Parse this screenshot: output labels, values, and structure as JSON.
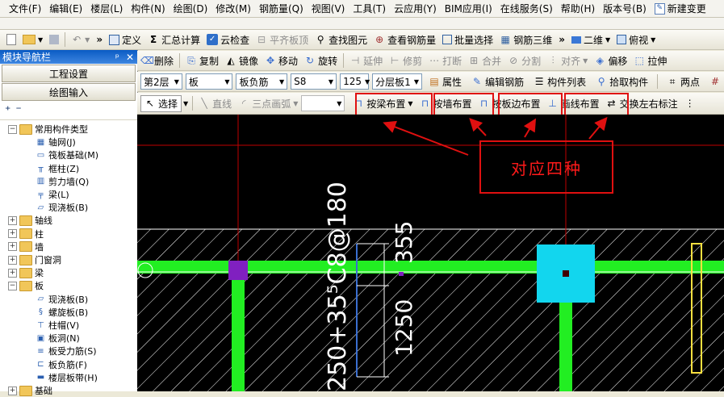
{
  "menubar": [
    "文件(F)",
    "编辑(E)",
    "楼层(L)",
    "构件(N)",
    "绘图(D)",
    "修改(M)",
    "钢筋量(Q)",
    "视图(V)",
    "工具(T)",
    "云应用(Y)",
    "BIM应用(I)",
    "在线服务(S)",
    "帮助(H)",
    "版本号(B)",
    "新建变更"
  ],
  "toolbar1": {
    "define": "定义",
    "sum": "汇总计算",
    "cloud_check": "云检查",
    "flush_slab": "平齐板顶",
    "find": "查找图元",
    "view_rebar": "查看钢筋量",
    "batch_select": "批量选择",
    "rebar_3d": "钢筋三维",
    "view_mode": "二维",
    "view_dir": "俯视"
  },
  "nav": {
    "title": "模块导航栏",
    "pin": "ᵖ",
    "close": "✕",
    "btn_project": "工程设置",
    "btn_draw": "绘图输入",
    "tree": [
      {
        "label": "常用构件类型",
        "level": 0,
        "type": "folder",
        "exp": "−"
      },
      {
        "label": "轴网(J)",
        "level": 1,
        "type": "leaf",
        "icon": "grid"
      },
      {
        "label": "筏板基础(M)",
        "level": 1,
        "type": "leaf",
        "icon": "raft"
      },
      {
        "label": "框柱(Z)",
        "level": 1,
        "type": "leaf",
        "icon": "column"
      },
      {
        "label": "剪力墙(Q)",
        "level": 1,
        "type": "leaf",
        "icon": "wall"
      },
      {
        "label": "梁(L)",
        "level": 1,
        "type": "leaf",
        "icon": "beam"
      },
      {
        "label": "现浇板(B)",
        "level": 1,
        "type": "leaf",
        "icon": "slab"
      },
      {
        "label": "轴线",
        "level": 0,
        "type": "folder",
        "exp": "+"
      },
      {
        "label": "柱",
        "level": 0,
        "type": "folder",
        "exp": "+"
      },
      {
        "label": "墙",
        "level": 0,
        "type": "folder",
        "exp": "+"
      },
      {
        "label": "门窗洞",
        "level": 0,
        "type": "folder",
        "exp": "+"
      },
      {
        "label": "梁",
        "level": 0,
        "type": "folder",
        "exp": "+"
      },
      {
        "label": "板",
        "level": 0,
        "type": "folder",
        "exp": "−"
      },
      {
        "label": "现浇板(B)",
        "level": 1,
        "type": "leaf",
        "icon": "slab"
      },
      {
        "label": "螺旋板(B)",
        "level": 1,
        "type": "leaf",
        "icon": "spiral"
      },
      {
        "label": "柱帽(V)",
        "level": 1,
        "type": "leaf",
        "icon": "cap"
      },
      {
        "label": "板洞(N)",
        "level": 1,
        "type": "leaf",
        "icon": "hole"
      },
      {
        "label": "板受力筋(S)",
        "level": 1,
        "type": "leaf",
        "icon": "rebar"
      },
      {
        "label": "板负筋(F)",
        "level": 1,
        "type": "leaf",
        "icon": "negrebar"
      },
      {
        "label": "楼层板带(H)",
        "level": 1,
        "type": "leaf",
        "icon": "band"
      },
      {
        "label": "基础",
        "level": 0,
        "type": "folder",
        "exp": "+"
      }
    ]
  },
  "toolbar2": {
    "delete": "删除",
    "copy": "复制",
    "mirror": "镜像",
    "move": "移动",
    "rotate": "旋转",
    "extend": "延伸",
    "trim": "修剪",
    "break": "打断",
    "merge": "合并",
    "split": "分割",
    "align": "对齐",
    "offset": "偏移",
    "stretch": "拉伸"
  },
  "toolbar3": {
    "floor": "第2层",
    "category": "板",
    "type": "板负筋",
    "name": "S8",
    "num": "125",
    "layer": "分层板1",
    "properties": "属性",
    "edit_rebar": "编辑钢筋",
    "component_list": "构件列表",
    "pick": "拾取构件",
    "two_point": "两点"
  },
  "toolbar4": {
    "select": "选择",
    "line": "直线",
    "arc": "三点画弧",
    "by_beam": "按梁布置",
    "by_wall": "按墙布置",
    "by_slab_edge": "按板边布置",
    "draw_line": "画线布置",
    "swap_label": "交换左右标注"
  },
  "annotation": "对应四种",
  "drawing": {
    "rebar_label": "250+35⁵C8@180",
    "dim_top": "355",
    "dim_side": "1250"
  }
}
